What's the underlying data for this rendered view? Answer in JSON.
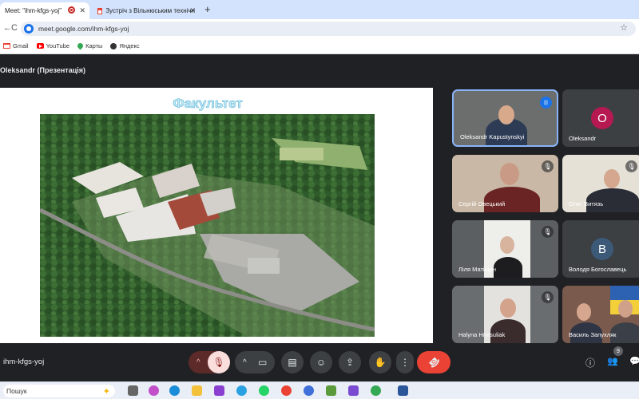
{
  "browser": {
    "tabs": [
      {
        "title": "Meet: \"ihm-kfgs-yoj\"",
        "active": true
      },
      {
        "title": "Зустріч з Вільнюським технічн",
        "active": false
      }
    ],
    "new_tab": "+",
    "close": "✕",
    "url": "meet.google.com/ihm-kfgs-yoj",
    "bookmarks": [
      "Gmail",
      "YouTube",
      "Карты",
      "Яндекс"
    ]
  },
  "meet": {
    "presenter_label": "Oleksandr (Презентація)",
    "slide_title": "Факультет",
    "meeting_code": "ihm-kfgs-yoj",
    "participant_count": "9",
    "participants": [
      {
        "name": "Oleksandr Kapustynskyi",
        "type": "video",
        "state": "speaking"
      },
      {
        "name": "Oleksandr",
        "type": "avatar",
        "initial": "O",
        "color": "#b5194f"
      },
      {
        "name": "Сергій Овецький",
        "type": "video",
        "state": "muted"
      },
      {
        "name": "Олег Витязь",
        "type": "video",
        "state": "muted"
      },
      {
        "name": "Ліля Матіщин",
        "type": "video",
        "state": "muted"
      },
      {
        "name": "Володя Богославець",
        "type": "avatar",
        "initial": "B",
        "color": "#3c5a78"
      },
      {
        "name": "Halyna Hrytsuliak",
        "type": "video",
        "state": "muted"
      },
      {
        "name": "Василь Запухляк",
        "type": "video",
        "state": "none"
      }
    ]
  },
  "taskbar": {
    "search_label": "Пошук"
  },
  "icons": {
    "back": "←",
    "reload": "C",
    "star": "☆",
    "mic_off": "🎙",
    "chevron": "^",
    "camera": "▭",
    "captions": "▤",
    "emoji": "☺",
    "present": "⇪",
    "hand": "✋",
    "more": "⋮",
    "hangup": "☎",
    "info": "ⓘ",
    "people": "👥",
    "chat": "💬"
  }
}
